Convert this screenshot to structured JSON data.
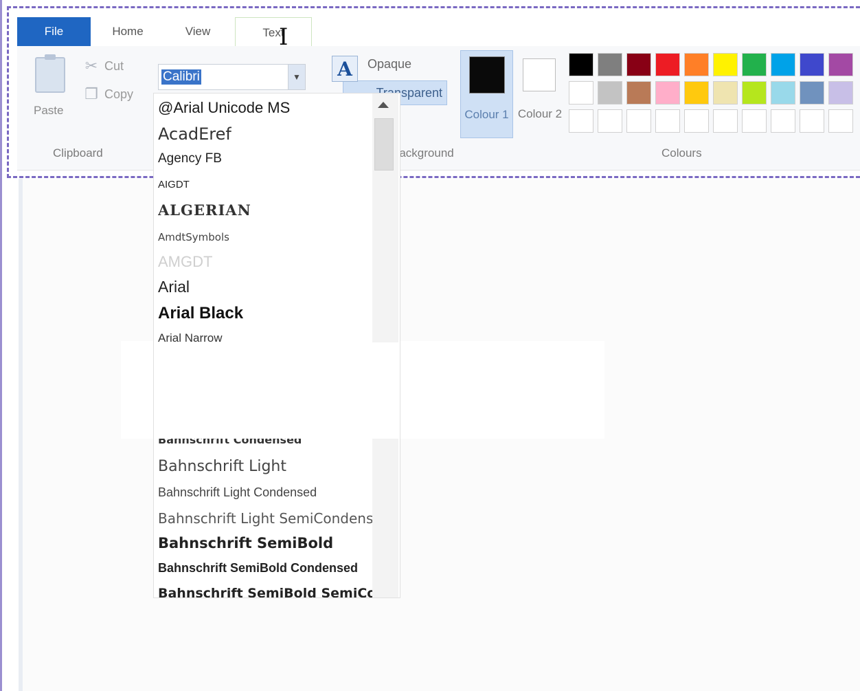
{
  "ribbon": {
    "tabs": [
      {
        "label": "File"
      },
      {
        "label": "Home"
      },
      {
        "label": "View"
      },
      {
        "label": "Text"
      }
    ]
  },
  "clipboard": {
    "paste_label": "Paste",
    "cut_label": "Cut",
    "copy_label": "Copy",
    "group_label": "Clipboard"
  },
  "font": {
    "current_value": "Calibri"
  },
  "background": {
    "opaque_label": "Opaque",
    "transparent_label": "Transparent",
    "group_label": "Background"
  },
  "colours": {
    "colour1_label": "Colour 1",
    "colour1_value": "#0a0a0a",
    "colour2_label": "Colour 2",
    "colour2_value": "#ffffff",
    "group_label": "Colours",
    "palette_row1": [
      "#000000",
      "#7f7f7f",
      "#880015",
      "#ed1c24",
      "#ff7f27",
      "#fff200",
      "#22b14c",
      "#00a2e8",
      "#3f48cc",
      "#a349a4"
    ],
    "palette_row2": [
      "#ffffff",
      "#c3c3c3",
      "#b97a57",
      "#ffaec9",
      "#ffc90e",
      "#efe4b0",
      "#b5e61d",
      "#99d9ea",
      "#7092be",
      "#c8bfe7"
    ],
    "palette_row3": [
      "#ffffff",
      "#ffffff",
      "#ffffff",
      "#ffffff",
      "#ffffff",
      "#ffffff",
      "#ffffff",
      "#ffffff",
      "#ffffff",
      "#ffffff"
    ]
  },
  "font_list": {
    "items": [
      "@Arial Unicode MS",
      "AcadEref",
      "Agency FB",
      "AIGDT",
      "ALGERIAN",
      "AmdtSymbols",
      "AMGDT",
      "Arial",
      "Arial Black",
      "Arial Narrow",
      "Bahnschrift Condensed",
      "Bahnschrift Light",
      "Bahnschrift Light Condensed",
      "Bahnschrift Light SemiCondens",
      "Bahnschrift SemiBold",
      "Bahnschrift SemiBold Condensed",
      "Bahnschrift SemiBold SemiCond"
    ]
  }
}
